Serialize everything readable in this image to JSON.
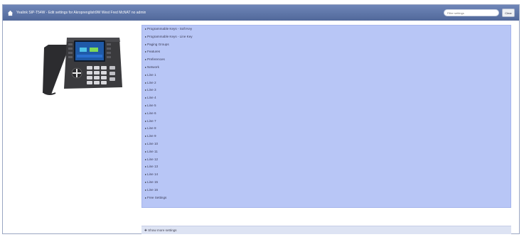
{
  "header": {
    "title": "Yealink SIP-T54W - Edit settings for Akroprenglish9W West Fred McNAT no admin",
    "filter_placeholder": "Filter settings",
    "clear_label": "Clear"
  },
  "settings": {
    "items": [
      {
        "label": "Programmable Keys - Soft Key"
      },
      {
        "label": "Programmable Keys - Line Key"
      },
      {
        "label": "Paging Groups"
      },
      {
        "label": "Features"
      },
      {
        "label": "Preferences"
      },
      {
        "label": "Network"
      },
      {
        "label": "Line 1"
      },
      {
        "label": "Line 2"
      },
      {
        "label": "Line 3"
      },
      {
        "label": "Line 4"
      },
      {
        "label": "Line 5"
      },
      {
        "label": "Line 6"
      },
      {
        "label": "Line 7"
      },
      {
        "label": "Line 8"
      },
      {
        "label": "Line 9"
      },
      {
        "label": "Line 10"
      },
      {
        "label": "Line 11"
      },
      {
        "label": "Line 12"
      },
      {
        "label": "Line 13"
      },
      {
        "label": "Line 14"
      },
      {
        "label": "Line 15"
      },
      {
        "label": "Line 16"
      },
      {
        "label": "Free Settings"
      }
    ]
  },
  "footer": {
    "show_more_label": "Show more settings"
  },
  "icons": {
    "home": "home-icon",
    "expand": "chevron-right-icon",
    "more": "plus-icon"
  },
  "colors": {
    "titlebar": "#5a71a6",
    "panel": "#b8c6f6"
  }
}
